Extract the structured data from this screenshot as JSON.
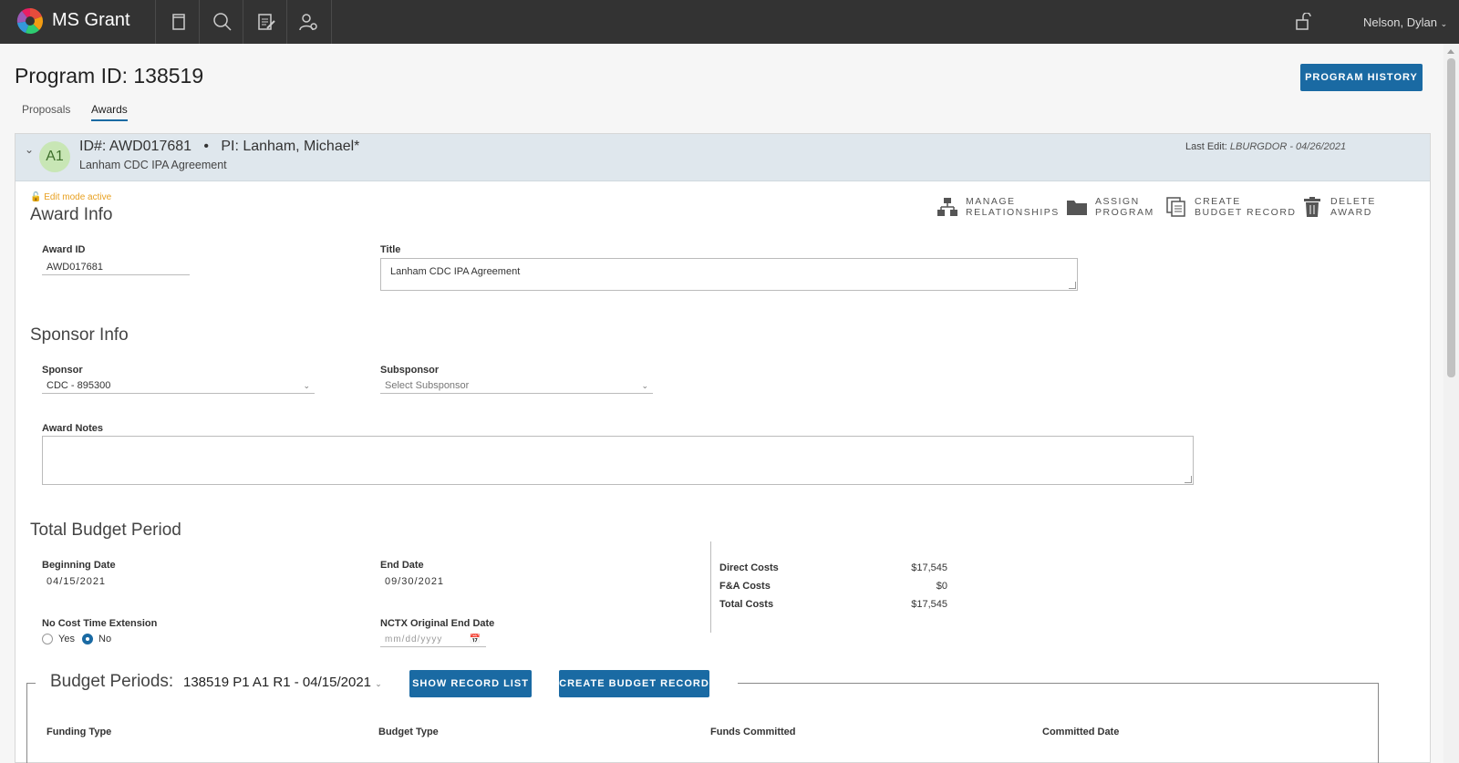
{
  "app": {
    "name": "MS Grant",
    "user": "Nelson, Dylan"
  },
  "page": {
    "title": "Program ID: 138519",
    "history_button": "PROGRAM HISTORY"
  },
  "tabs": [
    {
      "label": "Proposals"
    },
    {
      "label": "Awards"
    }
  ],
  "award": {
    "avatar": "A1",
    "id_line": "ID#: AWD017681",
    "pi": "PI: Lanham, Michael*",
    "subtitle": "Lanham CDC IPA Agreement",
    "last_edit_label": "Last Edit:",
    "last_edit_value": "LBURGDOR - 04/26/2021",
    "edit_mode": "Edit mode active"
  },
  "actions": [
    {
      "label": "MANAGE\nRELATIONSHIPS",
      "icon": "hierarchy-icon"
    },
    {
      "label": "ASSIGN\nPROGRAM",
      "icon": "folder-icon"
    },
    {
      "label": "CREATE\nBUDGET RECORD",
      "icon": "copy-icon"
    },
    {
      "label": "DELETE\nAWARD",
      "icon": "trash-icon"
    }
  ],
  "award_info": {
    "title": "Award Info",
    "award_id_label": "Award ID",
    "award_id_value": "AWD017681",
    "title_label": "Title",
    "title_value": "Lanham CDC IPA Agreement"
  },
  "sponsor_info": {
    "title": "Sponsor Info",
    "sponsor_label": "Sponsor",
    "sponsor_value": "CDC - 895300",
    "subsponsor_label": "Subsponsor",
    "subsponsor_placeholder": "Select Subsponsor",
    "notes_label": "Award Notes",
    "notes_value": ""
  },
  "budget_period": {
    "title": "Total Budget Period",
    "begin_label": "Beginning Date",
    "begin_value": "04/15/2021",
    "end_label": "End Date",
    "end_value": "09/30/2021",
    "nce_label": "No Cost Time Extension",
    "nce_yes": "Yes",
    "nce_no": "No",
    "nce_selected": "No",
    "nctx_label": "NCTX Original End Date",
    "nctx_placeholder": "mm/dd/yyyy",
    "costs": [
      {
        "label": "Direct Costs",
        "value": "$17,545"
      },
      {
        "label": "F&A Costs",
        "value": "$0"
      },
      {
        "label": "Total Costs",
        "value": "$17,545"
      }
    ]
  },
  "budget_periods": {
    "title": "Budget Periods:",
    "selected": "138519 P1 A1 R1 - 04/15/2021",
    "show_list_button": "SHOW RECORD LIST",
    "create_button": "CREATE BUDGET RECORD",
    "columns": [
      {
        "label": "Funding Type"
      },
      {
        "label": "Budget Type"
      },
      {
        "label": "Funds Committed"
      },
      {
        "label": "Committed Date"
      }
    ]
  }
}
